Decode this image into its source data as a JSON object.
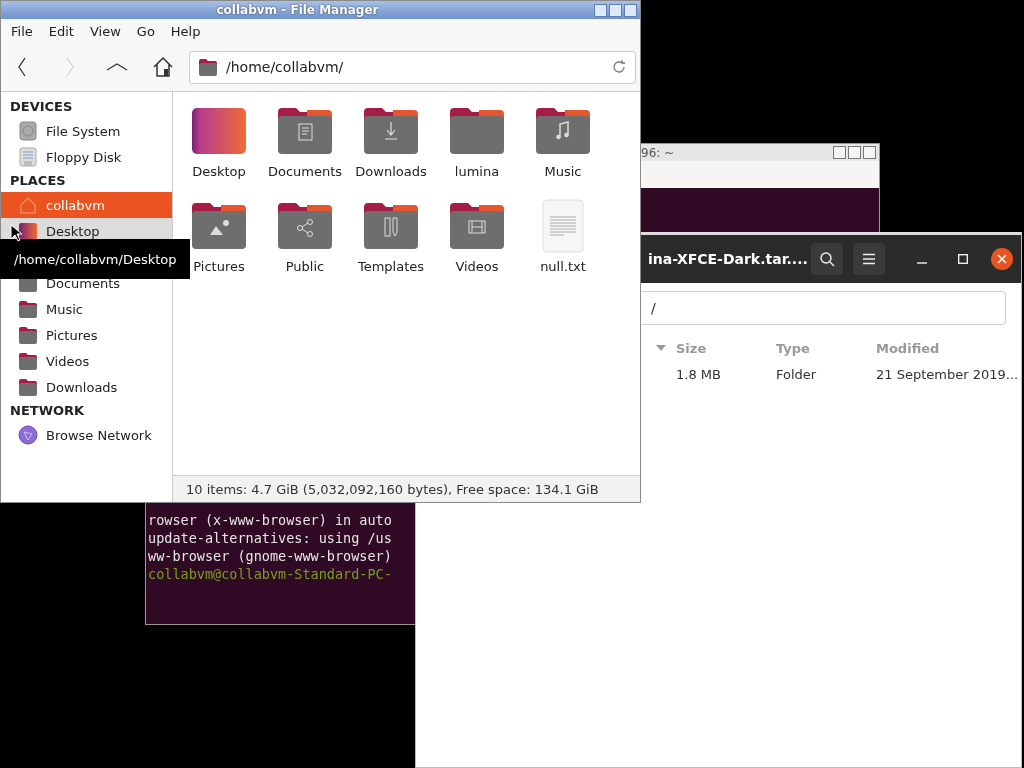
{
  "file_manager": {
    "title": "collabvm - File Manager",
    "menu": [
      "File",
      "Edit",
      "View",
      "Go",
      "Help"
    ],
    "nav": [
      {
        "kind": "back",
        "disabled": false
      },
      {
        "kind": "forward",
        "disabled": true
      },
      {
        "kind": "up",
        "disabled": false
      },
      {
        "kind": "home",
        "disabled": false
      }
    ],
    "address": "/home/collabvm/",
    "sidebar": [
      {
        "heading": "DEVICES",
        "items": [
          {
            "label": "File System",
            "kind": "drive",
            "selected": false,
            "hovered": false
          },
          {
            "label": "Floppy Disk",
            "kind": "floppy",
            "selected": false,
            "hovered": false
          }
        ]
      },
      {
        "heading": "PLACES",
        "items": [
          {
            "label": "collabvm",
            "kind": "home",
            "selected": true,
            "hovered": false
          },
          {
            "label": "Desktop",
            "kind": "desktop",
            "selected": false,
            "hovered": true
          },
          {
            "label": "Documents",
            "kind": "folder",
            "selected": false,
            "hovered": false
          },
          {
            "label": "Music",
            "kind": "folder",
            "selected": false,
            "hovered": false
          },
          {
            "label": "Pictures",
            "kind": "folder",
            "selected": false,
            "hovered": false
          },
          {
            "label": "Videos",
            "kind": "folder",
            "selected": false,
            "hovered": false
          },
          {
            "label": "Downloads",
            "kind": "folder",
            "selected": false,
            "hovered": false
          }
        ]
      },
      {
        "heading": "NETWORK",
        "items": [
          {
            "label": "Browse Network",
            "kind": "network",
            "selected": false,
            "hovered": false
          }
        ]
      }
    ],
    "files": [
      {
        "name": "Desktop",
        "kind": "desktop"
      },
      {
        "name": "Documents",
        "kind": "documents"
      },
      {
        "name": "Downloads",
        "kind": "downloads"
      },
      {
        "name": "lumina",
        "kind": "folder"
      },
      {
        "name": "Music",
        "kind": "music"
      },
      {
        "name": "Pictures",
        "kind": "pictures"
      },
      {
        "name": "Public",
        "kind": "public"
      },
      {
        "name": "Templates",
        "kind": "templates"
      },
      {
        "name": "Videos",
        "kind": "videos"
      },
      {
        "name": "null.txt",
        "kind": "text"
      }
    ],
    "status": "10 items: 4.7 GiB (5,032,092,160 bytes), Free space: 134.1 GiB",
    "tooltip": "/home/collabvm/Desktop"
  },
  "terminal": {
    "title": "96: ~",
    "lines": [
      {
        "text": "rowser (x-www-browser) in auto",
        "kind": "output"
      },
      {
        "text": "update-alternatives: using /us",
        "kind": "output"
      },
      {
        "text": "ww-browser (gnome-www-browser)",
        "kind": "output"
      },
      {
        "text": "collabvm@collabvm-Standard-PC-",
        "kind": "prompt"
      }
    ]
  },
  "archive_manager": {
    "title": "ina-XFCE-Dark.tar....",
    "path": "/",
    "columns": [
      "Size",
      "Type",
      "Modified"
    ],
    "rows": [
      [
        "1.8 MB",
        "Folder",
        "21 September 2019..."
      ]
    ]
  }
}
